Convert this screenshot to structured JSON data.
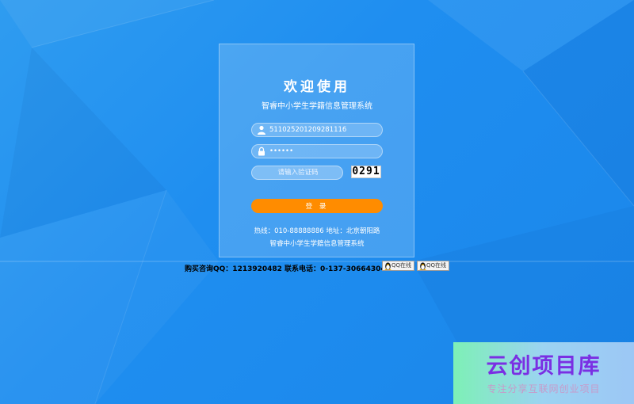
{
  "login": {
    "title": "欢迎使用",
    "subtitle": "智睿中小学生学籍信息管理系统",
    "username_value": "511025201209281116",
    "password_value": "••••••",
    "captcha_placeholder": "请输入验证码",
    "captcha_code": "0291",
    "login_button": "登 录",
    "contact_line": "热线：010-88888886 地址：北京朝阳路",
    "system_name": "智睿中小学生学籍信息管理系统"
  },
  "support": {
    "text": "购买咨询QQ：1213920482   联系电话：0-137-30664304",
    "qq_button_1": "QQ在线",
    "qq_button_2": "QQ在线"
  },
  "watermark": {
    "title": "云创项目库",
    "tagline": "专注分享互联网创业项目"
  },
  "colors": {
    "background": "#1f8ef0",
    "accent_button": "#ff8c00",
    "watermark_text": "#7a2fe3"
  },
  "icons": [
    "user-icon",
    "lock-icon",
    "qq-penguin-icon"
  ]
}
